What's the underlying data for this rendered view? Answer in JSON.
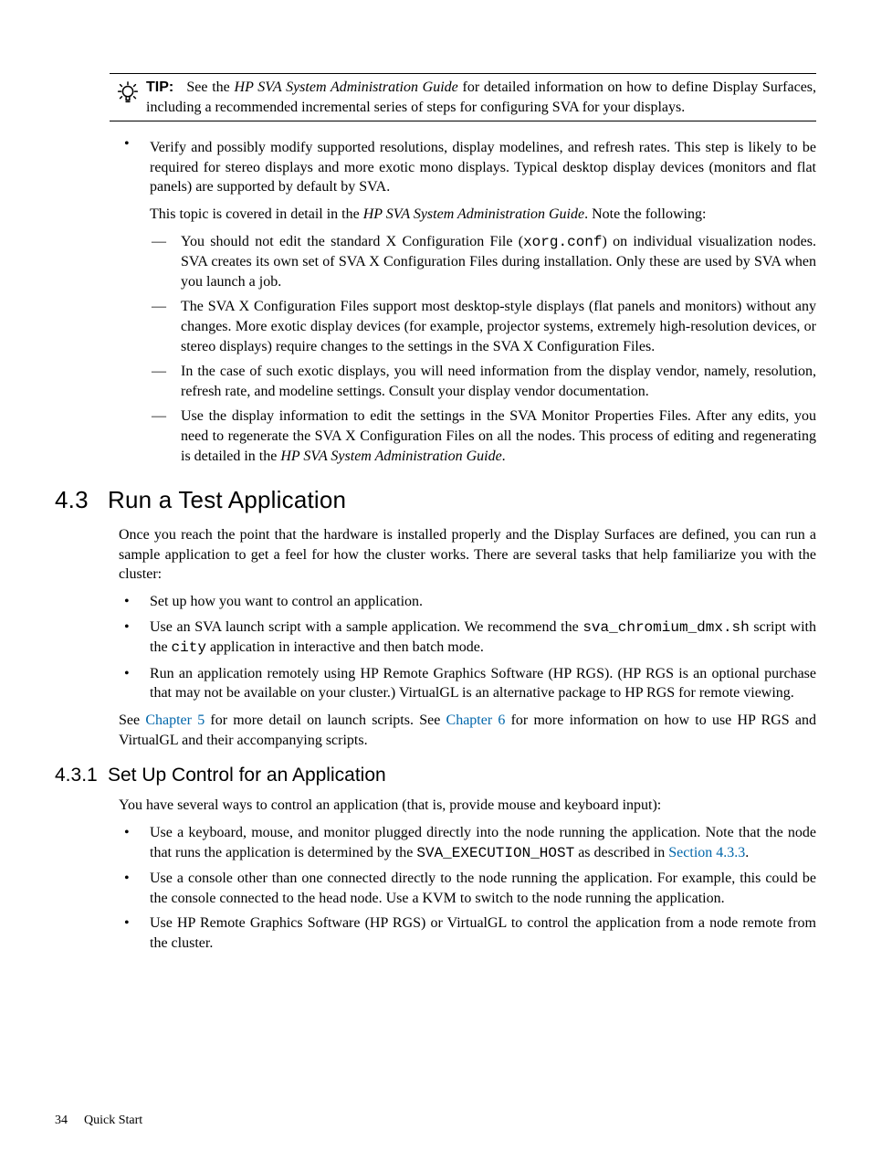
{
  "tip": {
    "label": "TIP:",
    "text_before": "See the ",
    "text_italic": "HP SVA System Administration Guide",
    "text_after": " for detailed information on how to define Display Surfaces, including a recommended incremental series of steps for configuring SVA for your displays."
  },
  "verify": {
    "para1": "Verify and possibly modify supported resolutions, display modelines, and refresh rates. This step is likely to be required for stereo displays and more exotic mono displays. Typical desktop display devices (monitors and flat panels) are supported by default by SVA.",
    "para2_a": "This topic is covered in detail in the ",
    "para2_i": "HP SVA System Administration Guide",
    "para2_b": ". Note the following:",
    "d1_a": "You should not edit the standard X Configuration File (",
    "d1_m": "xorg.conf",
    "d1_b": ") on individual visualization nodes. SVA creates its own set of SVA X Configuration Files during installation. Only these are used by SVA when you launch a job.",
    "d2": "The SVA X Configuration Files support most desktop-style displays (flat panels and monitors) without any changes. More exotic display devices (for example, projector systems, extremely high-resolution devices, or stereo displays) require changes to the settings in the SVA X Configuration Files.",
    "d3": "In the case of such exotic displays, you will need information from the display vendor, namely, resolution, refresh rate, and modeline settings. Consult your display vendor documentation.",
    "d4_a": "Use the display information to edit the settings in the SVA Monitor Properties Files. After any edits, you need to regenerate the SVA X Configuration Files on all the nodes. This process of editing and regenerating is detailed in the ",
    "d4_i": "HP SVA System Administration Guide",
    "d4_b": "."
  },
  "s43": {
    "num": "4.3",
    "title": "Run a Test Application",
    "intro": "Once you reach the point that the hardware is installed properly and the Display Surfaces are defined, you can run a sample application to get a feel for how the cluster works. There are several tasks that help familiarize you with the cluster:",
    "b1": "Set up how you want to control an application.",
    "b2_a": "Use an SVA launch script with a sample application. We recommend the ",
    "b2_m1": "sva_chromium_dmx.sh",
    "b2_b": " script with the ",
    "b2_m2": "city",
    "b2_c": " application in interactive and then batch mode.",
    "b3": "Run an application remotely using HP Remote Graphics Software (HP RGS). (HP RGS is an optional purchase that may not be available on your cluster.) VirtualGL is an alternative package to HP RGS for remote viewing.",
    "see_a": "See ",
    "see_l1": "Chapter 5",
    "see_b": " for more detail on launch scripts. See ",
    "see_l2": "Chapter 6",
    "see_c": " for more information on how to use HP RGS and VirtualGL and their accompanying scripts."
  },
  "s431": {
    "num": "4.3.1",
    "title": "Set Up Control for an Application",
    "intro": "You have several ways to control an application (that is, provide mouse and keyboard input):",
    "b1_a": "Use a keyboard, mouse, and monitor plugged directly into the node running the application. Note that the node that runs the application is determined by the ",
    "b1_m": "SVA_EXECUTION_HOST",
    "b1_b": " as described in ",
    "b1_l": "Section 4.3.3",
    "b1_c": ".",
    "b2": "Use a console other than one connected directly to the node running the application. For example, this could be the console connected to the head node. Use a KVM to switch to the node running the application.",
    "b3": "Use HP Remote Graphics Software (HP RGS) or VirtualGL to control the application from a node remote from the cluster."
  },
  "footer": {
    "page": "34",
    "chapter": "Quick Start"
  }
}
